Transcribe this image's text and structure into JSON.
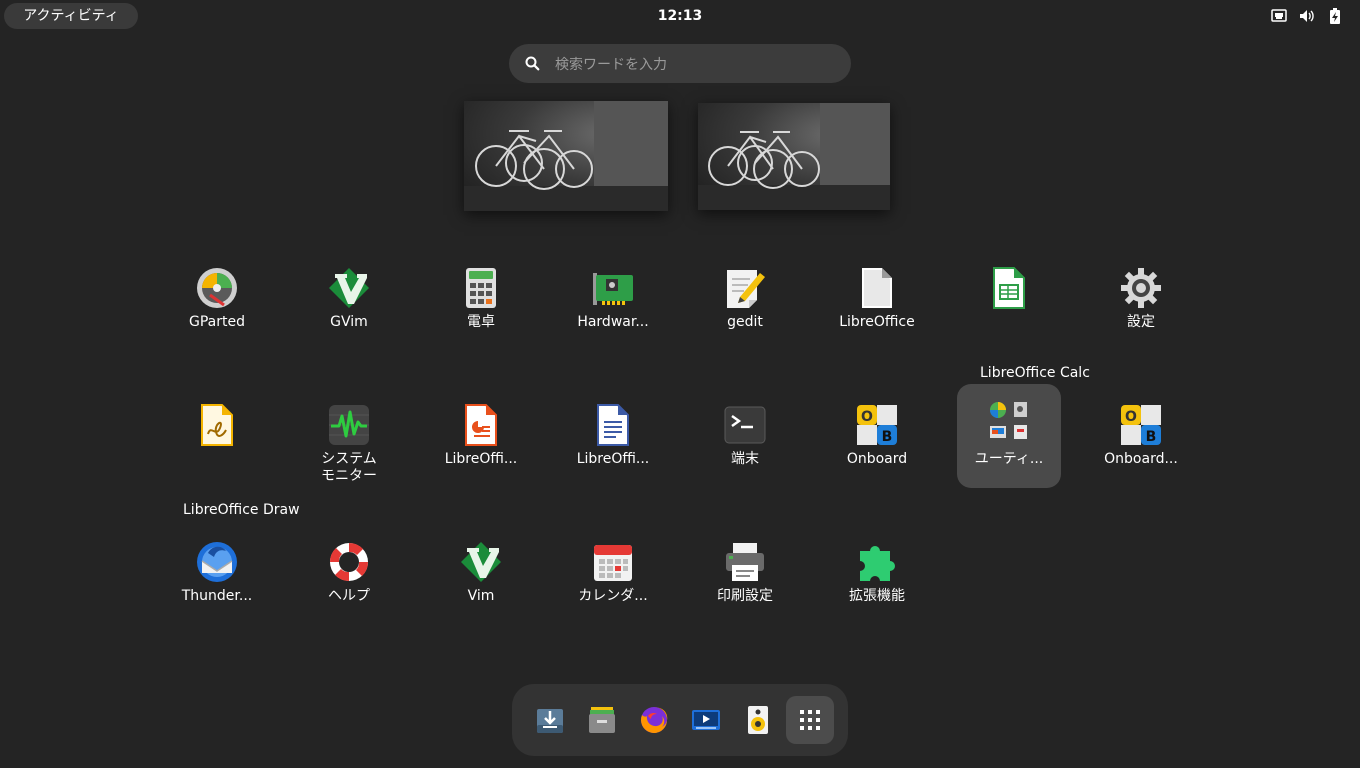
{
  "topbar": {
    "activities_label": "アクティビティ",
    "clock": "12:13"
  },
  "search": {
    "placeholder": "検索ワードを入力"
  },
  "apps": [
    {
      "label": "GParted",
      "icon": "gparted-icon"
    },
    {
      "label": "GVim",
      "icon": "vim-icon"
    },
    {
      "label": "電卓",
      "icon": "calculator-icon"
    },
    {
      "label": "Hardwar...",
      "icon": "hardware-icon"
    },
    {
      "label": "gedit",
      "icon": "gedit-icon"
    },
    {
      "label": "LibreOffice",
      "icon": "libreoffice-icon"
    },
    {
      "label": "",
      "icon": "libreoffice-calc-icon"
    },
    {
      "label": "設定",
      "icon": "settings-icon"
    },
    {
      "label": "",
      "icon": "libreoffice-draw-icon"
    },
    {
      "label": "システム\nモニター",
      "icon": "system-monitor-icon"
    },
    {
      "label": "LibreOffi...",
      "icon": "libreoffice-impress-icon"
    },
    {
      "label": "LibreOffi...",
      "icon": "libreoffice-writer-icon"
    },
    {
      "label": "端末",
      "icon": "terminal-icon"
    },
    {
      "label": "Onboard",
      "icon": "onboard-icon"
    },
    {
      "label": "ユーティ...",
      "icon": "utilities-folder-icon"
    },
    {
      "label": "Onboard...",
      "icon": "onboard-settings-icon"
    },
    {
      "label": "Thunder...",
      "icon": "thunderbird-icon"
    },
    {
      "label": "ヘルプ",
      "icon": "help-icon"
    },
    {
      "label": "Vim",
      "icon": "vim-icon"
    },
    {
      "label": "カレンダ...",
      "icon": "calendar-icon"
    },
    {
      "label": "印刷設定",
      "icon": "printer-icon"
    },
    {
      "label": "拡張機能",
      "icon": "extensions-icon"
    }
  ],
  "tooltips": {
    "calc": "LibreOffice Calc",
    "draw": "LibreOffice Draw"
  },
  "dash": [
    {
      "icon": "software-install-icon"
    },
    {
      "icon": "files-icon"
    },
    {
      "icon": "firefox-icon"
    },
    {
      "icon": "video-player-icon"
    },
    {
      "icon": "rhythmbox-icon"
    },
    {
      "icon": "show-apps-grid-icon"
    }
  ],
  "colors": {
    "background": "#242424",
    "selected": "#4a4a4a",
    "dash": "#333333"
  }
}
